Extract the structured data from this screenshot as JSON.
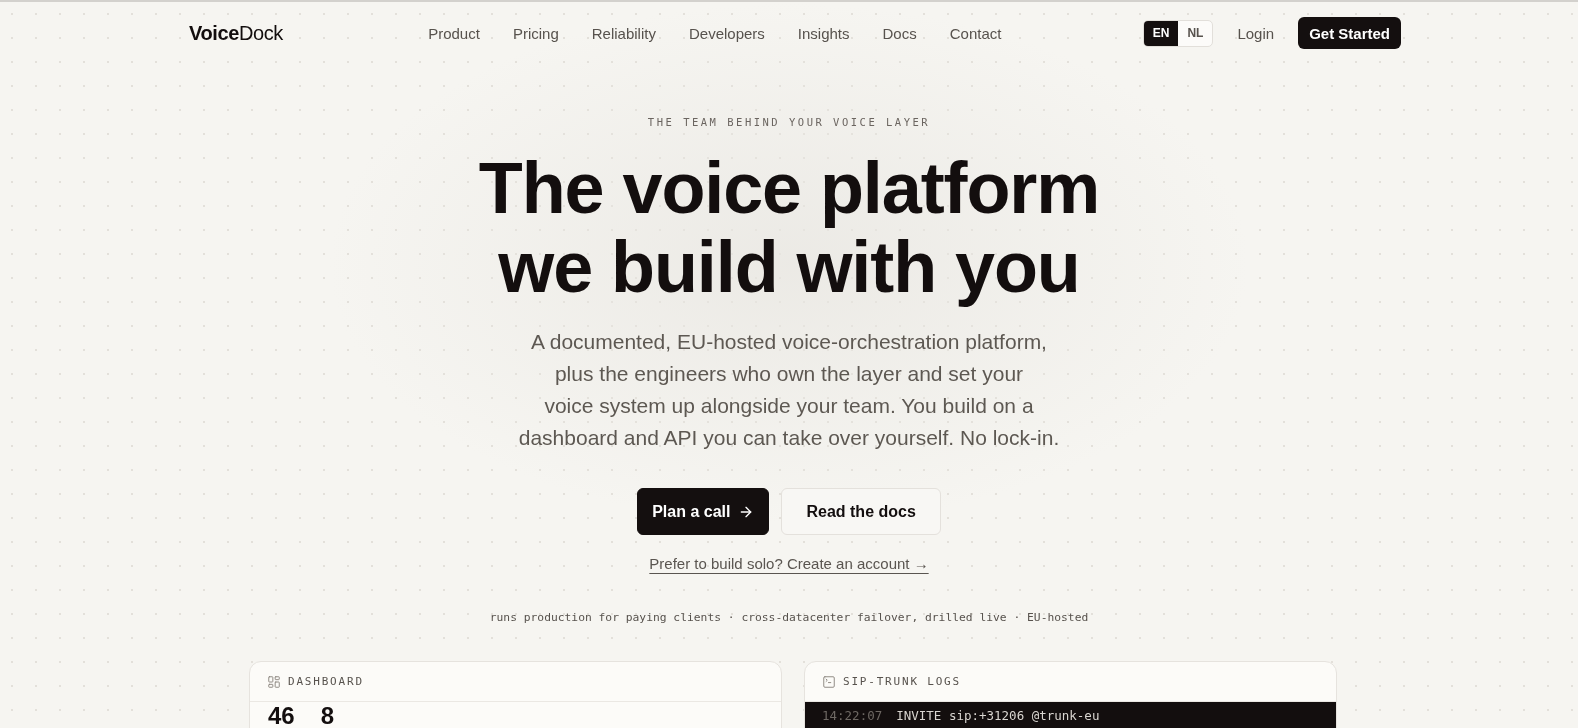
{
  "nav": {
    "logo": "**Voice**Dock",
    "links": [
      "Product",
      "Pricing",
      "Reliability",
      "Developers",
      "Insights",
      "Docs",
      "Contact"
    ],
    "languages": [
      {
        "label": "EN",
        "selected": true
      },
      {
        "label": "NL",
        "selected": false
      }
    ],
    "login": "Login",
    "cta": "Get Started"
  },
  "hero": {
    "eyebrow": "THE TEAM BEHIND YOUR VOICE LAYER",
    "headline": "The voice platform we build with you",
    "description": "A documented, EU-hosted voice-orchestration platform, plus the engineers who own the layer and set your voice system up alongside your team. You build on a dashboard and API you can take over yourself. No lock-in.",
    "buttons": [
      {
        "label": "Plan a call",
        "kind": "primary"
      },
      {
        "label": "Read the docs",
        "kind": "secondary"
      }
    ],
    "solo_link": "Prefer to build solo? Create an account →",
    "proof_line": "runs production for paying clients · cross-datacenter failover, drilled live · EU-hosted"
  },
  "cards": [
    {
      "kind": "dashboard",
      "title": "DASHBOARD",
      "stats": [
        "46",
        "8"
      ]
    },
    {
      "kind": "logs",
      "title": "SIP-TRUNK LOGS",
      "lines": [
        {
          "time": "14:22:07",
          "message": "INVITE sip:+31206 @trunk-eu"
        }
      ]
    }
  ]
}
